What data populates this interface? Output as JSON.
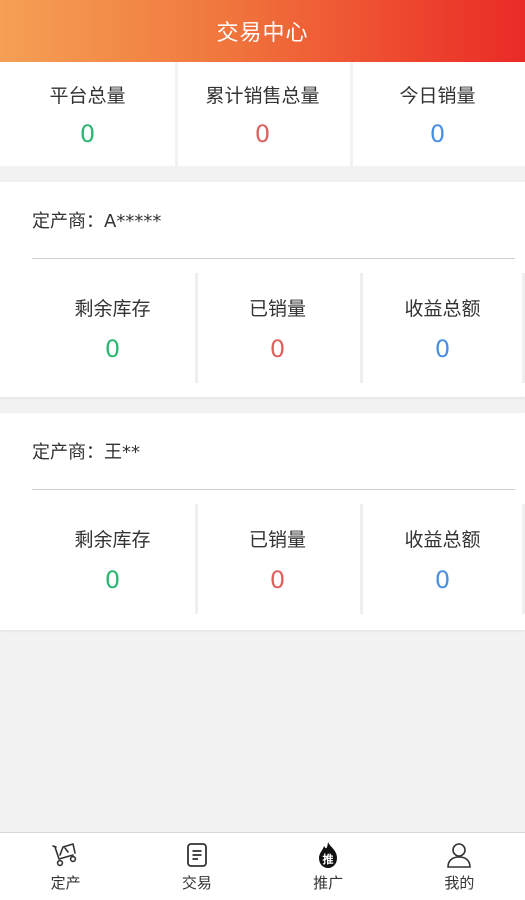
{
  "header": {
    "title": "交易中心"
  },
  "summary": [
    {
      "label": "平台总量",
      "value": "0",
      "color": "#2bb673"
    },
    {
      "label": "累计销售总量",
      "value": "0",
      "color": "#e06060"
    },
    {
      "label": "今日销量",
      "value": "0",
      "color": "#4a90e2"
    }
  ],
  "vendors": [
    {
      "title": "定产商：A*****",
      "stats": [
        {
          "label": "剩余库存",
          "value": "0"
        },
        {
          "label": "已销量",
          "value": "0"
        },
        {
          "label": "收益总额",
          "value": "0"
        }
      ]
    },
    {
      "title": "定产商：王**",
      "stats": [
        {
          "label": "剩余库存",
          "value": "0"
        },
        {
          "label": "已销量",
          "value": "0"
        },
        {
          "label": "收益总额",
          "value": "0"
        }
      ]
    }
  ],
  "tabbar": [
    {
      "label": "定产",
      "icon": "production-icon"
    },
    {
      "label": "交易",
      "icon": "document-icon"
    },
    {
      "label": "推广",
      "icon": "promote-fire-icon",
      "icon_text": "推"
    },
    {
      "label": "我的",
      "icon": "user-icon"
    }
  ]
}
